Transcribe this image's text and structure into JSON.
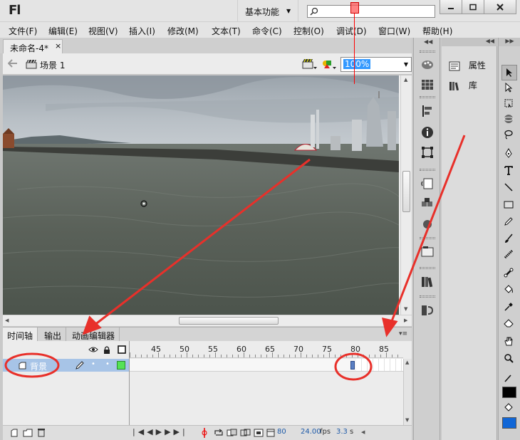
{
  "app": {
    "logo": "Fl",
    "workspace": "基本功能",
    "search": {
      "value": "",
      "placeholder": ""
    }
  },
  "menu": [
    "文件(F)",
    "编辑(E)",
    "视图(V)",
    "插入(I)",
    "修改(M)",
    "文本(T)",
    "命令(C)",
    "控制(O)",
    "调试(D)",
    "窗口(W)",
    "帮助(H)"
  ],
  "document": {
    "tab_title": "未命名-4*",
    "close_glyph": "×"
  },
  "scene": {
    "name": "场景 1",
    "zoom": "100%"
  },
  "timeline": {
    "tabs": [
      "时间轴",
      "输出",
      "动画编辑器"
    ],
    "ruler_labels": [
      "45",
      "50",
      "55",
      "60",
      "65",
      "70",
      "75",
      "80",
      "85"
    ],
    "layer": {
      "name": "背景"
    },
    "current_frame": "80",
    "fps": "24.00",
    "fps_unit": "fps",
    "elapsed": "3.3",
    "elapsed_unit": "s"
  },
  "properties_panel": {
    "items": [
      "属性",
      "库"
    ]
  },
  "colors": {
    "layer_selected": "#a7c4e7",
    "playhead": "#ff0000",
    "annotation": "#e8302a",
    "fill_color": "#1066d6",
    "stroke_color": "#000000"
  },
  "icons": {
    "dock": [
      "color-panel-icon",
      "swatches-icon",
      "align-icon",
      "info-icon",
      "transform-icon",
      "code-snippets-icon",
      "components-icon",
      "motion-presets-icon",
      "project-icon",
      "library-icon",
      "behaviors-icon"
    ],
    "tools": [
      "selection-tool-icon",
      "subselection-tool-icon",
      "free-transform-tool-icon",
      "3d-rotation-tool-icon",
      "lasso-tool-icon",
      "pen-tool-icon",
      "text-tool-icon",
      "line-tool-icon",
      "rectangle-tool-icon",
      "pencil-tool-icon",
      "brush-tool-icon",
      "deco-tool-icon",
      "bone-tool-icon",
      "paint-bucket-tool-icon",
      "eyedropper-tool-icon",
      "eraser-tool-icon",
      "hand-tool-icon",
      "zoom-tool-icon",
      "stroke-color-icon",
      "fill-color-icon"
    ]
  }
}
